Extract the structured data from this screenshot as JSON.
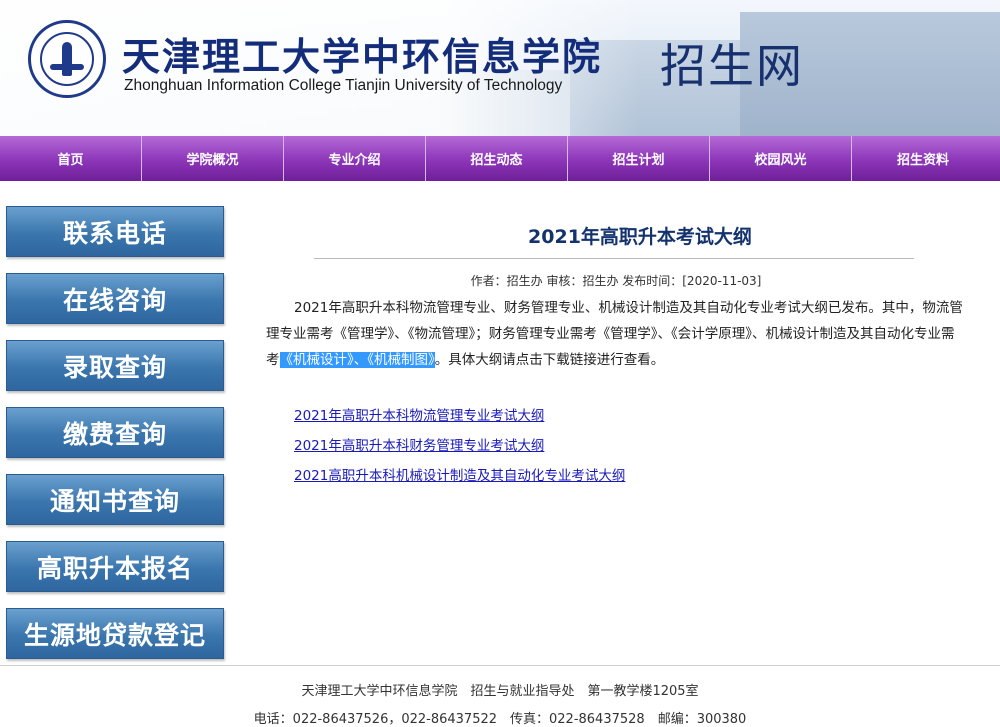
{
  "header": {
    "school_name_cn": "天津理工大学中环信息学院",
    "school_name_en": "Zhonghuan Information College Tianjin University of Technology",
    "site_name": "招生网",
    "logo_icon": "college-emblem-icon"
  },
  "nav": {
    "items": [
      {
        "label": "首页"
      },
      {
        "label": "学院概况"
      },
      {
        "label": "专业介绍"
      },
      {
        "label": "招生动态"
      },
      {
        "label": "招生计划"
      },
      {
        "label": "校园风光"
      },
      {
        "label": "招生资料"
      }
    ]
  },
  "sidebar": {
    "items": [
      {
        "label": "联系电话"
      },
      {
        "label": "在线咨询"
      },
      {
        "label": "录取查询"
      },
      {
        "label": "缴费查询"
      },
      {
        "label": "通知书查询"
      },
      {
        "label": "高职升本报名"
      },
      {
        "label": "生源地贷款登记"
      }
    ]
  },
  "article": {
    "title": "2021年高职升本考试大纲",
    "meta": "作者：招生办 审核：招生办 发布时间：[2020-11-03]",
    "body_part1": "2021年高职升本科物流管理专业、财务管理专业、机械设计制造及其自动化专业考试大纲已发布。其中，物流管理专业需考《管理学》、《物流管理》；财务管理专业需考《管理学》、《会计学原理》、机械设计制造及其自动化专业需考",
    "body_highlight": "《机械设计》、《机械制图》",
    "body_part2": "。具体大纲请点击下载链接进行查看。",
    "links": [
      {
        "label": "2021年高职升本科物流管理专业考试大纲"
      },
      {
        "label": "2021年高职升本科财务管理专业考试大纲"
      },
      {
        "label": "2021高职升本科机械设计制造及其自动化专业考试大纲"
      }
    ]
  },
  "footer": {
    "line1": "天津理工大学中环信息学院　招生与就业指导处　第一教学楼1205室",
    "line2": "电话：022-86437526，022-86437522　传真：022-86437528　邮编：300380"
  },
  "colors": {
    "nav_purple": "#8c35b8",
    "sidebar_blue": "#3a76ad",
    "title_navy": "#14336e",
    "link_blue": "#1a1ab8",
    "selection_highlight": "#3399ff"
  }
}
